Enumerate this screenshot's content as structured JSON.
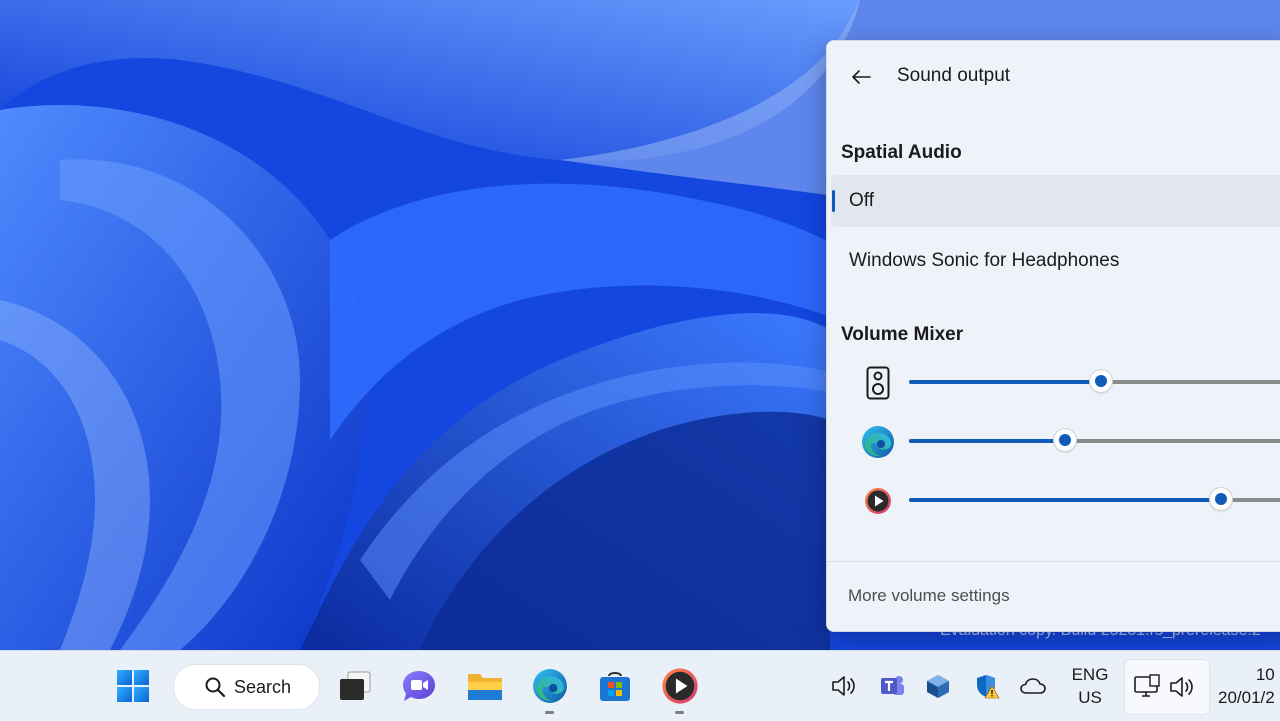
{
  "flyout": {
    "title": "Sound output",
    "spatial_audio": {
      "heading": "Spatial Audio",
      "options": [
        {
          "label": "Off",
          "selected": true
        },
        {
          "label": "Windows Sonic for Headphones",
          "selected": false
        }
      ]
    },
    "volume_mixer": {
      "heading": "Volume Mixer",
      "apps": [
        {
          "icon": "speaker-icon",
          "level": 0.48
        },
        {
          "icon": "edge-icon",
          "level": 0.39
        },
        {
          "icon": "media-player-icon",
          "level": 0.78
        }
      ]
    },
    "footer_link": "More volume settings"
  },
  "watermark": "Evaluation copy. Build 25281.rs_prerelease.2",
  "taskbar": {
    "search_label": "Search",
    "pinned": [
      "start-icon",
      "task-view-icon",
      "teams-chat-icon",
      "file-explorer-icon",
      "edge-icon",
      "store-icon",
      "media-player-icon"
    ],
    "tray": [
      "volume-icon",
      "teams-icon",
      "virtualbox-icon",
      "defender-icon",
      "onedrive-icon"
    ],
    "language_line1": "ENG",
    "language_line2": "US",
    "clock_time": "10",
    "clock_date": "20/01/2"
  },
  "colors": {
    "accent": "#0f5bb8",
    "flyout_bg": "#eef3fa",
    "taskbar_bg": "#eaf0f8"
  }
}
